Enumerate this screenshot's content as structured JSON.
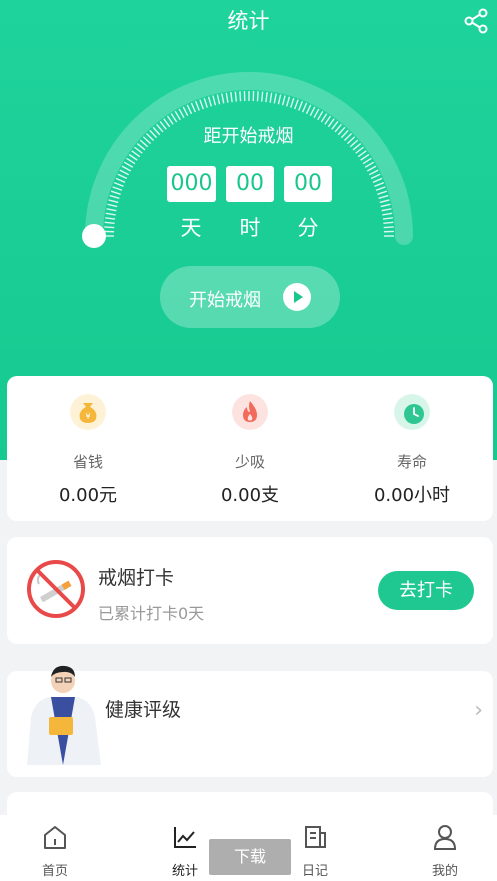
{
  "header": {
    "title": "统计",
    "share_icon": "share-icon"
  },
  "timer": {
    "caption": "距开始戒烟",
    "days": "000",
    "hours": "00",
    "minutes": "00",
    "units": {
      "days": "天",
      "hours": "时",
      "minutes": "分"
    },
    "progress": 0
  },
  "start_button": {
    "label": "开始戒烟",
    "icon": "play-icon"
  },
  "stats": [
    {
      "label": "省钱",
      "value": "0.00元",
      "icon": "money-bag-icon",
      "color": "#f5b73b"
    },
    {
      "label": "少吸",
      "value": "0.00支",
      "icon": "flame-icon",
      "color": "#f26a5c"
    },
    {
      "label": "寿命",
      "value": "0.00小时",
      "icon": "clock-icon",
      "color": "#2ec793"
    }
  ],
  "checkin": {
    "title": "戒烟打卡",
    "subtitle": "已累计打卡0天",
    "button": "去打卡",
    "icon": "no-smoking-icon"
  },
  "health": {
    "title": "健康评级",
    "icon": "doctor-illustration"
  },
  "download_label": "下载",
  "tabbar": [
    {
      "label": "首页",
      "icon": "home-icon"
    },
    {
      "label": "统计",
      "icon": "chart-icon"
    },
    {
      "label": "日记",
      "icon": "diary-icon"
    },
    {
      "label": "我的",
      "icon": "user-icon"
    }
  ],
  "colors": {
    "primary": "#1fd39c",
    "accent": "#19c68e"
  }
}
